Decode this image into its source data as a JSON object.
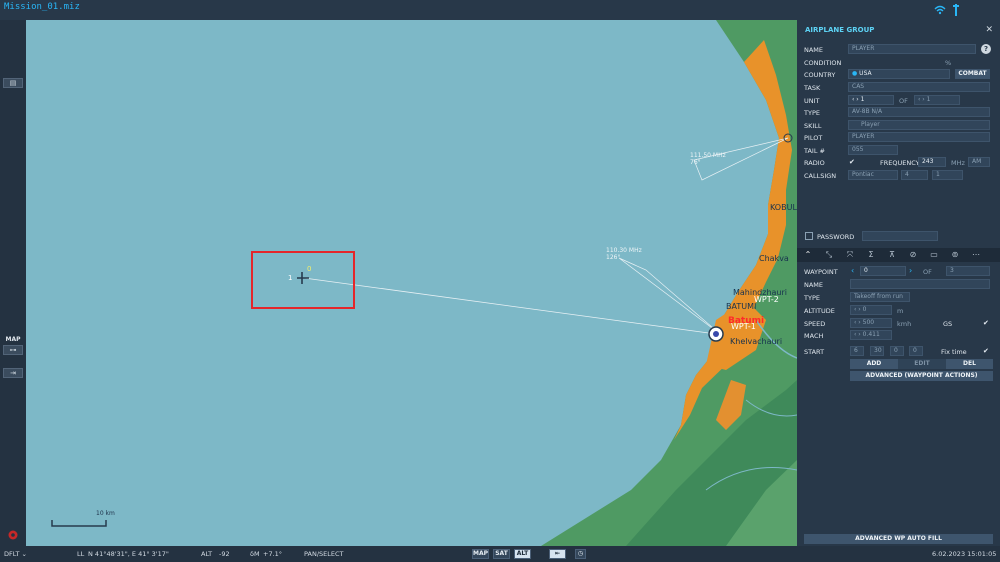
{
  "window": {
    "title": "Mission_01.miz"
  },
  "leftbar": {
    "map_label": "MAP"
  },
  "map": {
    "cities": [
      "KOBULI",
      "Chakva",
      "Mahindzhauri",
      "BATUMI",
      "Batumi",
      "Khelvachauri"
    ],
    "waypoints": {
      "wp1": "WPT-1",
      "wp2": "WPT-2"
    },
    "beacons": [
      {
        "freq": "111.50 MHz",
        "bearing": "76°"
      },
      {
        "freq": "110.30 MHz",
        "bearing": "126°"
      }
    ],
    "group_markers": {
      "left": "1",
      "top": "0"
    },
    "scale_label": "10 km"
  },
  "panel": {
    "title": "AIRPLANE GROUP",
    "help": "?",
    "labels": {
      "name": "NAME",
      "condition": "CONDITION",
      "country": "COUNTRY",
      "task": "TASK",
      "unit": "UNIT",
      "of": "OF",
      "type": "TYPE",
      "skill": "SKILL",
      "pilot": "PILOT",
      "tail": "TAIL #",
      "radio": "RADIO",
      "frequency": "FREQUENCY",
      "callsign": "CALLSIGN",
      "password": "PASSWORD"
    },
    "values": {
      "name": "PLAYER",
      "condition_unit": "%",
      "country": "USA",
      "combat": "COMBAT",
      "task": "CAS",
      "unit": "1",
      "unit_of": "1",
      "type": "AV-8B N/A",
      "skill": "Player",
      "pilot": "PLAYER",
      "tail": "055",
      "frequency": "243",
      "freq_unit": "MHz",
      "modulation": "AM",
      "callsign_name": "Pontiac",
      "callsign_num1": "4",
      "callsign_num2": "1"
    },
    "waypoint": {
      "labels": {
        "waypoint": "WAYPOINT",
        "of": "OF",
        "name": "NAME",
        "type": "TYPE",
        "altitude": "ALTITUDE",
        "speed": "SPEED",
        "mach": "MACH",
        "start": "START",
        "gs": "GS",
        "fix_time": "Fix time"
      },
      "values": {
        "index": "0",
        "total": "3",
        "type": "Takeoff from run",
        "altitude": "0",
        "alt_unit": "m",
        "speed": "500",
        "speed_unit": "kmh",
        "mach": "0.411",
        "start_d": "6",
        "start_h": "30",
        "start_m": "0",
        "start_s": "0"
      },
      "buttons": {
        "add": "ADD",
        "edit": "EDIT",
        "del": "DEL",
        "advanced": "ADVANCED (WAYPOINT ACTIONS)"
      }
    },
    "auto_fill": "ADVANCED WP AUTO FILL"
  },
  "statusbar": {
    "layer": "DFLT",
    "ll_label": "LL",
    "coords": "N 41°48'31\", E 41° 3'17\"",
    "alt_label": "ALT",
    "alt_value": "-92",
    "dm_label": "δM",
    "dm_value": "+7.1°",
    "mode": "PAN/SELECT",
    "map_modes": [
      "MAP",
      "SAT",
      "ALT"
    ],
    "datetime": "6.02.2023 15:01:05"
  },
  "colors": {
    "sea": "#7db8c7",
    "urban": "#e8922a",
    "accent": "#29b6f6",
    "selection": "#e5262a"
  }
}
